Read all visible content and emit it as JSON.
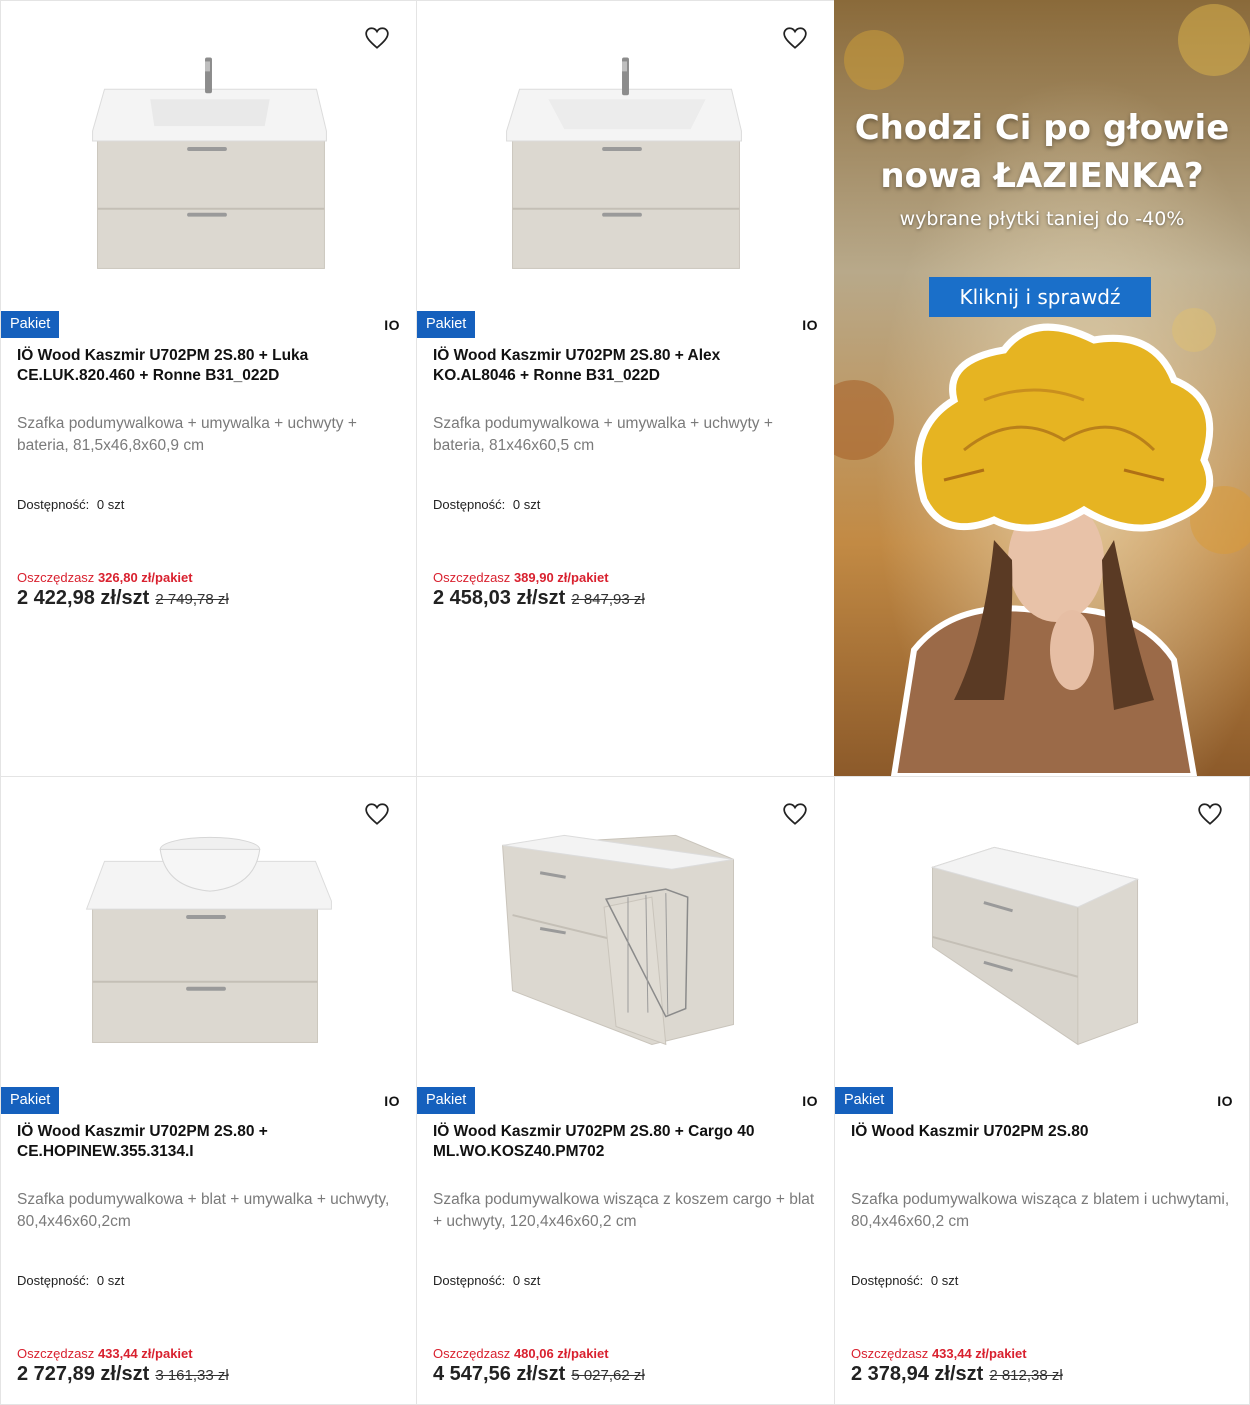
{
  "promo": {
    "headline_line1": "Chodzi Ci po głowie",
    "headline_line2": "nowa ŁAZIENKA?",
    "subline": "wybrane płytki taniej do -40%",
    "cta_label": "Kliknij i sprawdź"
  },
  "products": [
    {
      "badge": "Pakiet",
      "brand": "IO",
      "title": "IÖ Wood Kaszmir U702PM 2S.80 + Luka CE.LUK.820.460 + Ronne B31_022D",
      "description": "Szafka podumywalkowa + umywalka + uchwyty + bateria, 81,5x46,8x60,9 cm",
      "availability_label": "Dostępność:",
      "availability_value": "0 szt",
      "save_label": "Oszczędzasz",
      "save_amount": "326,80 zł/pakiet",
      "price": "2 422,98 zł/szt",
      "old_price": "2 749,78 zł",
      "image": "vanity-with-sink-icon"
    },
    {
      "badge": "Pakiet",
      "brand": "IO",
      "title": "IÖ Wood Kaszmir U702PM 2S.80 + Alex KO.AL8046 + Ronne B31_022D",
      "description": "Szafka podumywalkowa + umywalka + uchwyty + bateria, 81x46x60,5 cm",
      "availability_label": "Dostępność:",
      "availability_value": "0 szt",
      "save_label": "Oszczędzasz",
      "save_amount": "389,90 zł/pakiet",
      "price": "2 458,03 zł/szt",
      "old_price": "2 847,93 zł",
      "image": "vanity-with-sink-icon"
    },
    {
      "badge": "Pakiet",
      "brand": "IO",
      "title": "IÖ Wood Kaszmir U702PM 2S.80 + CE.HOPINEW.355.3134.I",
      "description": "Szafka podumywalkowa + blat + umywalka + uchwyty, 80,4x46x60,2cm",
      "availability_label": "Dostępność:",
      "availability_value": "0 szt",
      "save_label": "Oszczędzasz",
      "save_amount": "433,44 zł/pakiet",
      "price": "2 727,89 zł/szt",
      "old_price": "3 161,33 zł",
      "image": "vanity-with-bowl-icon"
    },
    {
      "badge": "Pakiet",
      "brand": "IO",
      "title": "IÖ Wood Kaszmir U702PM 2S.80 + Cargo 40 ML.WO.KOSZ40.PM702",
      "description": "Szafka podumywalkowa wisząca z koszem cargo + blat + uchwyty, 120,4x46x60,2 cm",
      "availability_label": "Dostępność:",
      "availability_value": "0 szt",
      "save_label": "Oszczędzasz",
      "save_amount": "480,06 zł/pakiet",
      "price": "4 547,56 zł/szt",
      "old_price": "5 027,62 zł",
      "image": "vanity-with-cargo-icon"
    },
    {
      "badge": "Pakiet",
      "brand": "IO",
      "title": "IÖ Wood Kaszmir U702PM 2S.80",
      "description": "Szafka podumywalkowa wisząca z blatem i uchwytami, 80,4x46x60,2 cm",
      "availability_label": "Dostępność:",
      "availability_value": "0 szt",
      "save_label": "Oszczędzasz",
      "save_amount": "433,44 zł/pakiet",
      "price": "2 378,94 zł/szt",
      "old_price": "2 812,38 zł",
      "image": "vanity-cabinet-icon"
    }
  ],
  "colors": {
    "badge": "#1560bd",
    "save_red": "#d9212f",
    "cta": "#1a6fc9",
    "cabinet": "#dcd8d0"
  }
}
